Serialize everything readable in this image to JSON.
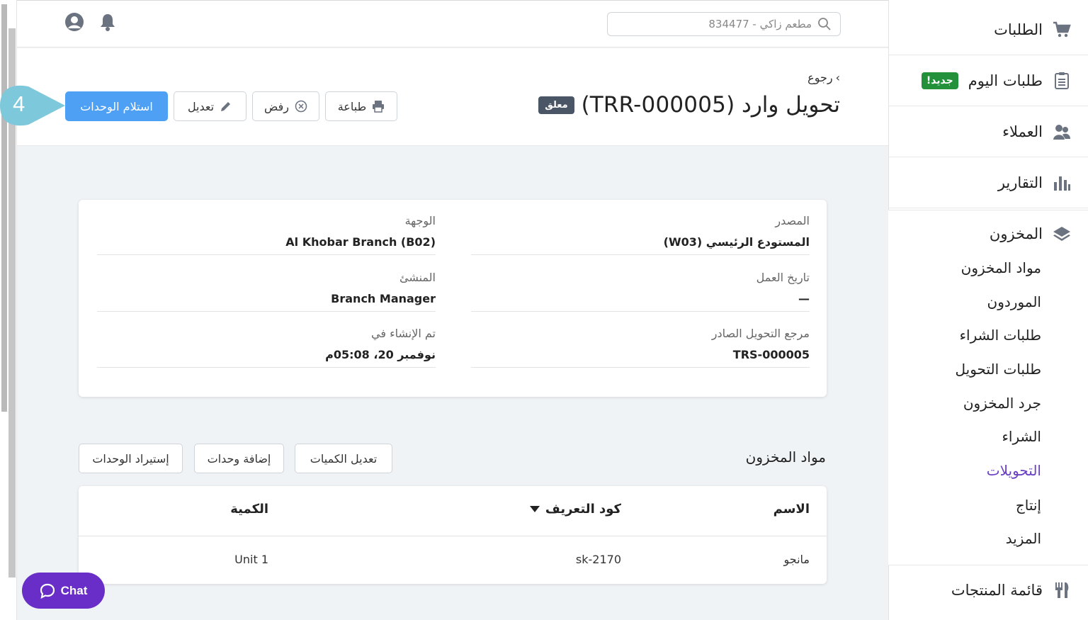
{
  "search": {
    "placeholder": "مطعم زاكي - 834477"
  },
  "header": {
    "back_label": "رجوع",
    "title": "تحويل وارد (TRR-000005)",
    "status_badge": "معلق"
  },
  "actions": {
    "print": "طباعة",
    "reject": "رفض",
    "edit": "تعديل",
    "receive": "استلام الوحدات"
  },
  "step_number": "4",
  "details": {
    "source_label": "المصدر",
    "source_value": "المستودع الرئيسي (W03)",
    "destination_label": "الوجهة",
    "destination_value": "Al Khobar Branch (B02)",
    "business_date_label": "تاريخ العمل",
    "business_date_value": "—",
    "creator_label": "المنشئ",
    "creator_value": "Branch Manager",
    "outgoing_ref_label": "مرجع التحويل الصادر",
    "outgoing_ref_value": "TRS-000005",
    "created_at_label": "تم الإنشاء في",
    "created_at_value": "نوفمبر 20، 05:08م"
  },
  "items_section": {
    "title": "مواد المخزون",
    "edit_quantities": "تعديل الكميات",
    "add_units": "إضافة وحدات",
    "import_units": "إستيراد الوحدات",
    "columns": {
      "name": "الاسم",
      "sku": "كود التعريف",
      "quantity": "الكمية"
    },
    "rows": [
      {
        "name": "مانجو",
        "sku": "sk-2170",
        "quantity": "1 Unit"
      }
    ]
  },
  "chat_label": "Chat",
  "sidebar": {
    "orders": "الطلبات",
    "today_orders": "طلبات اليوم",
    "new_badge": "جديد!",
    "customers": "العملاء",
    "reports": "التقارير",
    "inventory": "المخزون",
    "inventory_items": "مواد المخزون",
    "suppliers": "الموردون",
    "purchase_orders": "طلبات الشراء",
    "transfer_orders": "طلبات التحويل",
    "inventory_count": "جرد المخزون",
    "purchasing": "الشراء",
    "transfers": "التحويلات",
    "production": "إنتاج",
    "more": "المزيد",
    "menu": "قائمة المنتجات"
  },
  "colors": {
    "primary": "#4ea0f5",
    "active_nav": "#6a3fc4",
    "chat": "#6a2ec8",
    "new_badge": "#22913a",
    "step_badge": "#7ec8dc"
  }
}
